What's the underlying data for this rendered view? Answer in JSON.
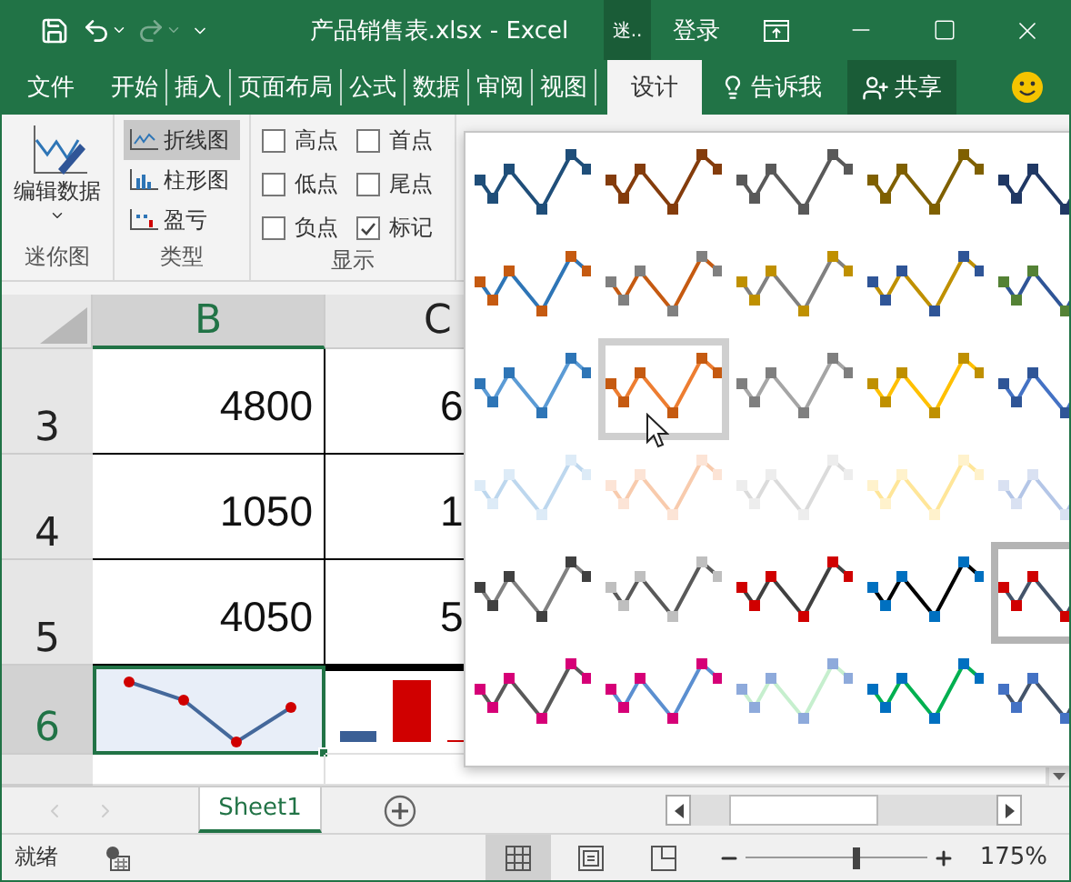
{
  "title_bar": {
    "title": "产品销售表.xlsx - Excel",
    "context_label": "迷..",
    "sign_in": "登录"
  },
  "tabs": [
    {
      "label": "文件",
      "selected": false
    },
    {
      "label": "开始",
      "selected": false
    },
    {
      "label": "插入",
      "selected": false
    },
    {
      "label": "页面布局",
      "selected": false
    },
    {
      "label": "公式",
      "selected": false
    },
    {
      "label": "数据",
      "selected": false
    },
    {
      "label": "审阅",
      "selected": false
    },
    {
      "label": "视图",
      "selected": false
    },
    {
      "label": "设计",
      "selected": true
    }
  ],
  "tell_me": "告诉我",
  "share": "共享",
  "ribbon": {
    "edit_data": "编辑数据",
    "sparkline_group": "迷你图",
    "type_group": "类型",
    "show_group": "显示",
    "types": [
      {
        "label": "折线图",
        "kind": "line",
        "selected": true
      },
      {
        "label": "柱形图",
        "kind": "column",
        "selected": false
      },
      {
        "label": "盈亏",
        "kind": "winloss",
        "selected": false
      }
    ],
    "show_options": [
      {
        "label": "高点",
        "checked": false
      },
      {
        "label": "首点",
        "checked": false
      },
      {
        "label": "低点",
        "checked": false
      },
      {
        "label": "尾点",
        "checked": false
      },
      {
        "label": "负点",
        "checked": false
      },
      {
        "label": "标记",
        "checked": true
      }
    ]
  },
  "columns": [
    {
      "label": "B",
      "selected": true
    },
    {
      "label": "C",
      "selected": false
    }
  ],
  "rows": [
    {
      "header": "3",
      "selected": false,
      "cells": [
        {
          "kind": "value",
          "text": "4800"
        },
        {
          "kind": "value",
          "text": "6"
        }
      ]
    },
    {
      "header": "4",
      "selected": false,
      "cells": [
        {
          "kind": "value",
          "text": "1050"
        },
        {
          "kind": "value",
          "text": "1"
        }
      ]
    },
    {
      "header": "5",
      "selected": false,
      "cells": [
        {
          "kind": "value",
          "text": "4050"
        },
        {
          "kind": "value",
          "text": "5"
        }
      ]
    },
    {
      "header": "6",
      "selected": true,
      "cells": [
        {
          "kind": "line_sparkline"
        },
        {
          "kind": "column_sparkline"
        }
      ]
    },
    {
      "selected": false,
      "cells": [
        {
          "kind": "empty"
        },
        {
          "kind": "empty"
        }
      ]
    }
  ],
  "gallery": {
    "styles": [
      {
        "line": {
          "color": "#1f4e79"
        },
        "marker": {
          "color": "#1f4e79"
        },
        "selected": false,
        "hovered": false
      },
      {
        "line": {
          "color": "#843c0c"
        },
        "marker": {
          "color": "#843c0c"
        },
        "selected": false,
        "hovered": false
      },
      {
        "line": {
          "color": "#595959"
        },
        "marker": {
          "color": "#595959"
        },
        "selected": false,
        "hovered": false
      },
      {
        "line": {
          "color": "#7f6000"
        },
        "marker": {
          "color": "#7f6000"
        },
        "selected": false,
        "hovered": false
      },
      {
        "line": {
          "color": "#203864"
        },
        "marker": {
          "color": "#203864"
        },
        "selected": false,
        "hovered": false
      },
      {
        "line": {
          "color": "#2e75b6"
        },
        "marker": {
          "color": "#c55a11"
        },
        "selected": false,
        "hovered": false
      },
      {
        "line": {
          "color": "#c55a11"
        },
        "marker": {
          "color": "#808080"
        },
        "selected": false,
        "hovered": false
      },
      {
        "line": {
          "color": "#808080"
        },
        "marker": {
          "color": "#bf9000"
        },
        "selected": false,
        "hovered": false
      },
      {
        "line": {
          "color": "#bf9000"
        },
        "marker": {
          "color": "#2f5597"
        },
        "selected": false,
        "hovered": false
      },
      {
        "line": {
          "color": "#2f5597"
        },
        "marker": {
          "color": "#548235"
        },
        "selected": false,
        "hovered": false
      },
      {
        "line": {
          "color": "#5b9bd5"
        },
        "marker": {
          "color": "#2e75b6"
        },
        "selected": false,
        "hovered": false
      },
      {
        "line": {
          "color": "#ed7d31"
        },
        "marker": {
          "color": "#c55a11"
        },
        "selected": false,
        "hovered": true
      },
      {
        "line": {
          "color": "#a5a5a5"
        },
        "marker": {
          "color": "#7f7f7f"
        },
        "selected": false,
        "hovered": false
      },
      {
        "line": {
          "color": "#ffc000"
        },
        "marker": {
          "color": "#bf9000"
        },
        "selected": false,
        "hovered": false
      },
      {
        "line": {
          "color": "#4472c4"
        },
        "marker": {
          "color": "#2f5597"
        },
        "selected": false,
        "hovered": false
      },
      {
        "line": {
          "color": "#bdd7ee"
        },
        "marker": {
          "color": "#ddebf7"
        },
        "selected": false,
        "hovered": false
      },
      {
        "line": {
          "color": "#f8cbad"
        },
        "marker": {
          "color": "#fce4d6"
        },
        "selected": false,
        "hovered": false
      },
      {
        "line": {
          "color": "#dbdbdb"
        },
        "marker": {
          "color": "#ededed"
        },
        "selected": false,
        "hovered": false
      },
      {
        "line": {
          "color": "#ffe699"
        },
        "marker": {
          "color": "#fff2cc"
        },
        "selected": false,
        "hovered": false
      },
      {
        "line": {
          "color": "#b4c6e7"
        },
        "marker": {
          "color": "#d9e1f2"
        },
        "selected": false,
        "hovered": false
      },
      {
        "line": {
          "color": "#808080"
        },
        "marker": {
          "color": "#404040"
        },
        "selected": false,
        "hovered": false
      },
      {
        "line": {
          "color": "#595959"
        },
        "marker": {
          "color": "#bfbfbf"
        },
        "selected": false,
        "hovered": false
      },
      {
        "line": {
          "color": "#404040"
        },
        "marker": {
          "color": "#d00000"
        },
        "selected": false,
        "hovered": false
      },
      {
        "line": {
          "color": "#000000"
        },
        "marker": {
          "color": "#0070c0"
        },
        "selected": false,
        "hovered": false
      },
      {
        "line": {
          "color": "#44546a"
        },
        "marker": {
          "color": "#d00000"
        },
        "selected": true,
        "hovered": false
      },
      {
        "line": {
          "color": "#595959"
        },
        "marker": {
          "color": "#d60077"
        },
        "selected": false,
        "hovered": false
      },
      {
        "line": {
          "color": "#5b8fd0"
        },
        "marker": {
          "color": "#d60077"
        },
        "selected": false,
        "hovered": false
      },
      {
        "line": {
          "color": "#c6efce"
        },
        "marker": {
          "color": "#8eaadb"
        },
        "selected": false,
        "hovered": false
      },
      {
        "line": {
          "color": "#00b050"
        },
        "marker": {
          "color": "#0070c0"
        },
        "selected": false,
        "hovered": false
      },
      {
        "line": {
          "color": "#44546a"
        },
        "marker": {
          "color": "#4472c4"
        },
        "selected": false,
        "hovered": false
      }
    ]
  },
  "sheets": [
    {
      "label": "Sheet1",
      "selected": true
    }
  ],
  "status": {
    "text": "就绪",
    "zoom": "175%",
    "level": 0.61,
    "views": [
      {
        "kind": "normal",
        "selected": true
      },
      {
        "kind": "page_layout",
        "selected": false
      },
      {
        "kind": "page_break",
        "selected": false
      }
    ]
  }
}
